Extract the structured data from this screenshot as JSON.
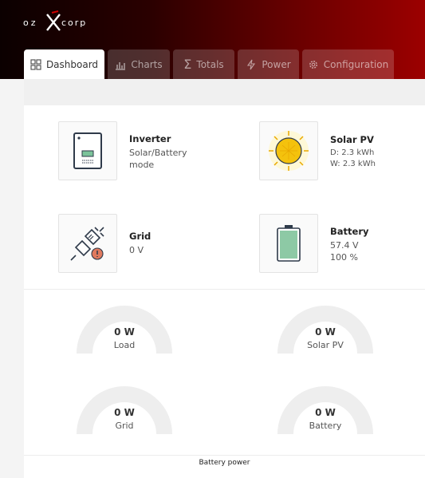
{
  "brand": {
    "name": "OZXCORP"
  },
  "tabs": [
    {
      "label": "Dashboard",
      "icon": "dashboard-grid-icon",
      "active": true
    },
    {
      "label": "Charts",
      "icon": "bar-chart-icon",
      "active": false
    },
    {
      "label": "Totals",
      "icon": "sigma-icon",
      "active": false
    },
    {
      "label": "Power",
      "icon": "lightning-icon",
      "active": false
    },
    {
      "label": "Configuration",
      "icon": "gear-icon",
      "active": false
    }
  ],
  "devices": {
    "inverter": {
      "title": "Inverter",
      "line1": "Solar/Battery",
      "line2": "mode"
    },
    "solar": {
      "title": "Solar PV",
      "line1": "D: 2.3 kWh",
      "line2": "W: 2.3 kWh"
    },
    "grid": {
      "title": "Grid",
      "line1": "0 V"
    },
    "battery": {
      "title": "Battery",
      "line1": "57.4 V",
      "line2": "100 %"
    }
  },
  "gauges": [
    {
      "value": "0 W",
      "label": "Load"
    },
    {
      "value": "0 W",
      "label": "Solar PV"
    },
    {
      "value": "0 W",
      "label": "Grid"
    },
    {
      "value": "0 W",
      "label": "Battery"
    }
  ],
  "battery_power": {
    "title": "Battery power"
  },
  "colors": {
    "header_dark": "#0b0000",
    "header_red": "#9c0000",
    "gauge": "#eeeeee",
    "sun": "#f4c20d",
    "battery_fill": "#8dc9a5"
  }
}
